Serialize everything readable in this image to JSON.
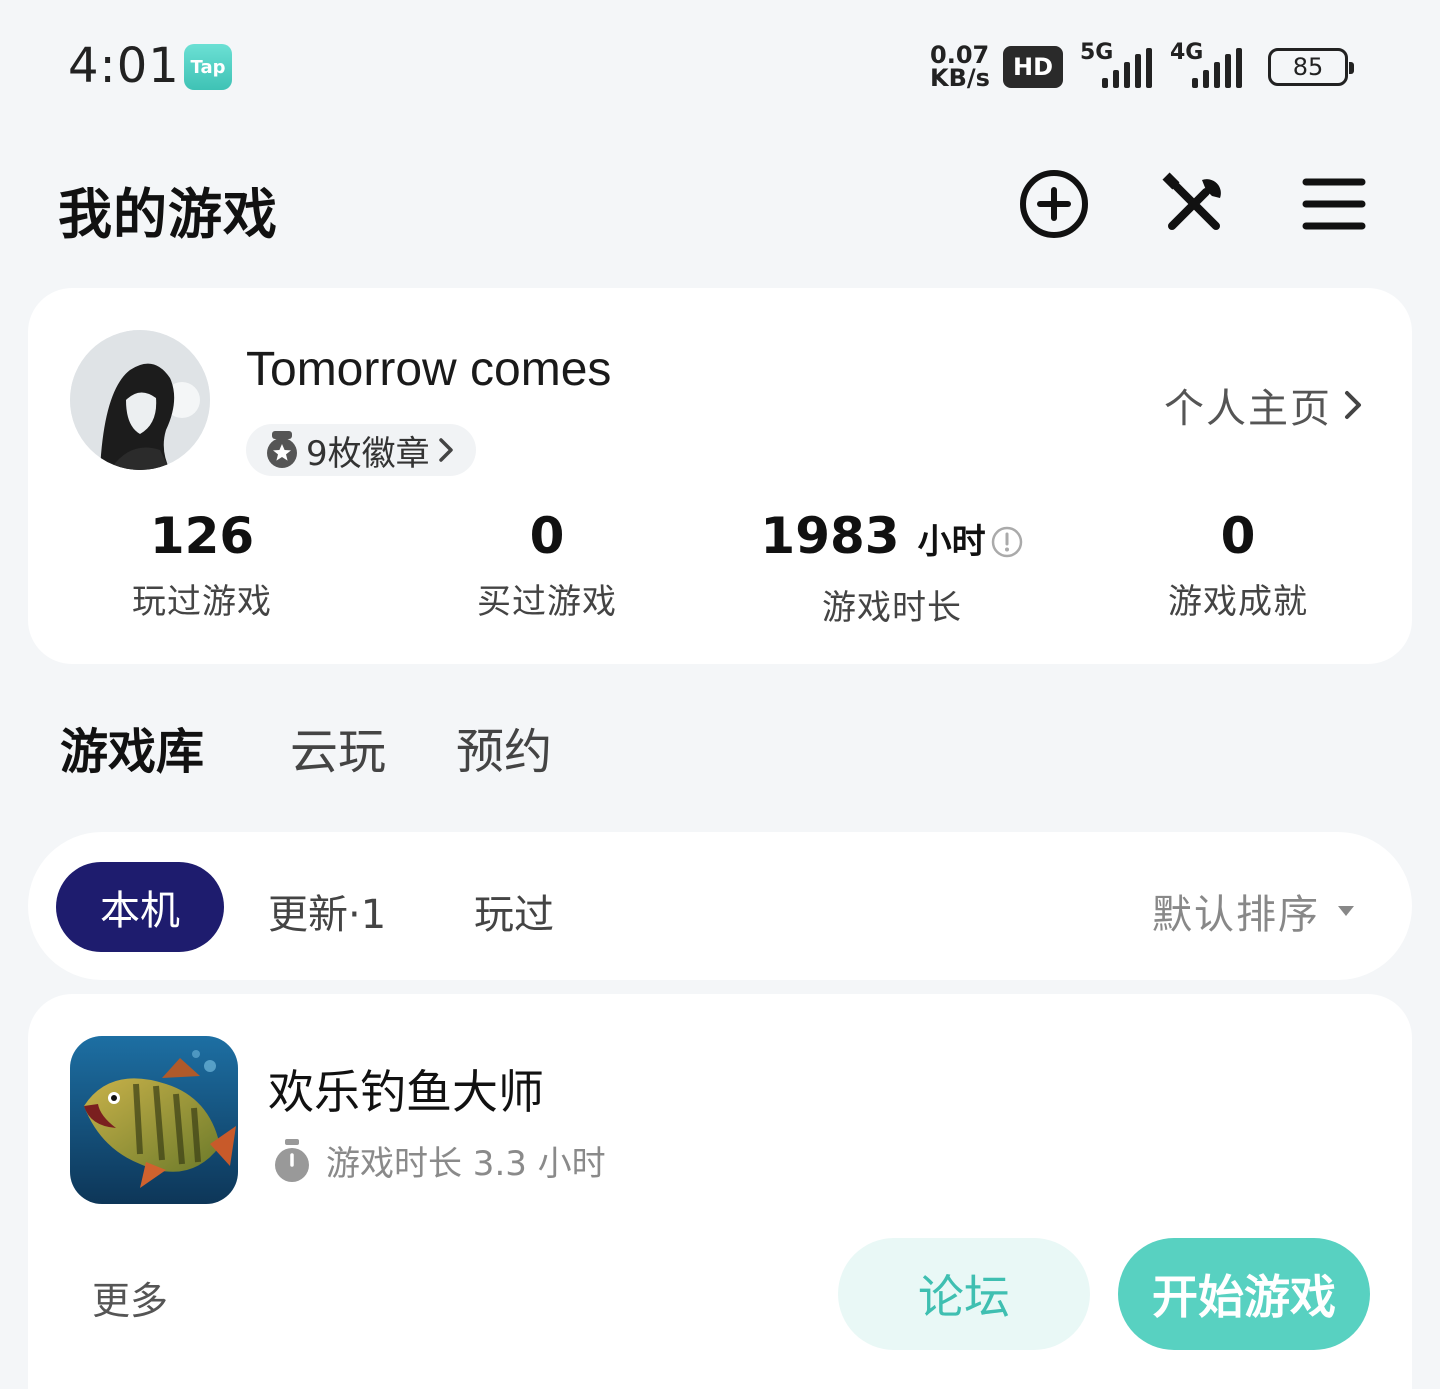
{
  "status_bar": {
    "time": "4:01",
    "tap_badge": "Tap",
    "net_speed_value": "0.07",
    "net_speed_unit": "KB/s",
    "hd_label": "HD",
    "signal_5g": "5G",
    "signal_4g": "4G",
    "battery": "85"
  },
  "header": {
    "title": "我的游戏",
    "icons": [
      "add-circle-icon",
      "tools-icon",
      "menu-icon"
    ]
  },
  "profile": {
    "username": "Tomorrow comes",
    "badges_label": "9枚徽章",
    "profile_link": "个人主页",
    "stats": [
      {
        "value": "126",
        "label": "玩过游戏"
      },
      {
        "value": "0",
        "label": "买过游戏"
      },
      {
        "value": "1983",
        "unit": "小时",
        "label": "游戏时长"
      },
      {
        "value": "0",
        "label": "游戏成就"
      }
    ]
  },
  "main_tabs": [
    "游戏库",
    "云玩",
    "预约"
  ],
  "filter": {
    "chips": [
      "本机",
      "更新·1",
      "玩过"
    ],
    "sort_label": "默认排序"
  },
  "game": {
    "name": "欢乐钓鱼大师",
    "playtime": "游戏时长 3.3 小时",
    "more": "更多",
    "forum_button": "论坛",
    "play_button": "开始游戏"
  },
  "colors": {
    "accent_teal": "#58d1c1",
    "chip_active_bg": "#1e1c6e",
    "forum_bg": "#e9f8f6",
    "background": "#f4f6f8"
  }
}
